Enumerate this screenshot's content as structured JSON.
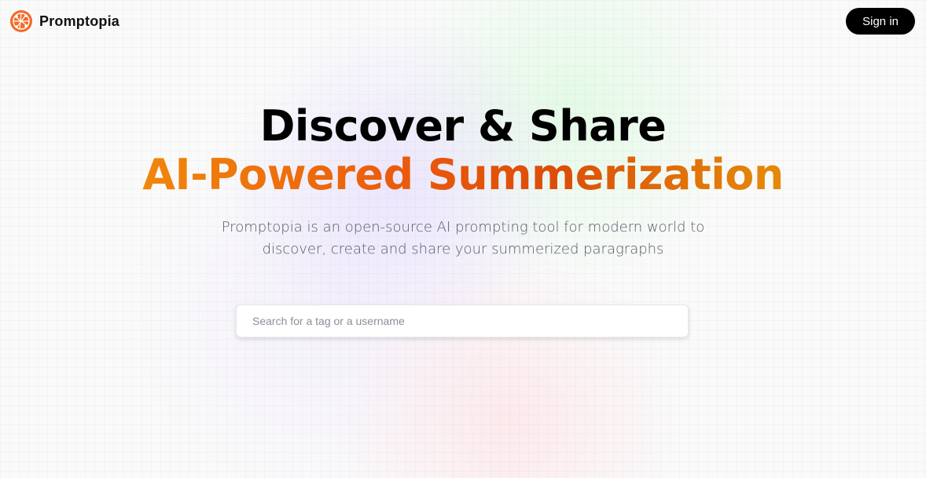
{
  "nav": {
    "brand_name": "Promptopia",
    "logo_icon": "promptopia-logo-icon",
    "signin_label": "Sign in"
  },
  "hero": {
    "line1": "Discover & Share",
    "line2": "AI-Powered Summerization",
    "description": "Promptopia is an open-source AI prompting tool for modern world to discover, create and share your summerized paragraphs"
  },
  "search": {
    "value": "",
    "placeholder": "Search for a tag or a username"
  },
  "colors": {
    "accent_orange": "#ea580c",
    "accent_amber": "#f59e0b",
    "accent_yellow": "#eab308",
    "button_bg": "#000000"
  }
}
